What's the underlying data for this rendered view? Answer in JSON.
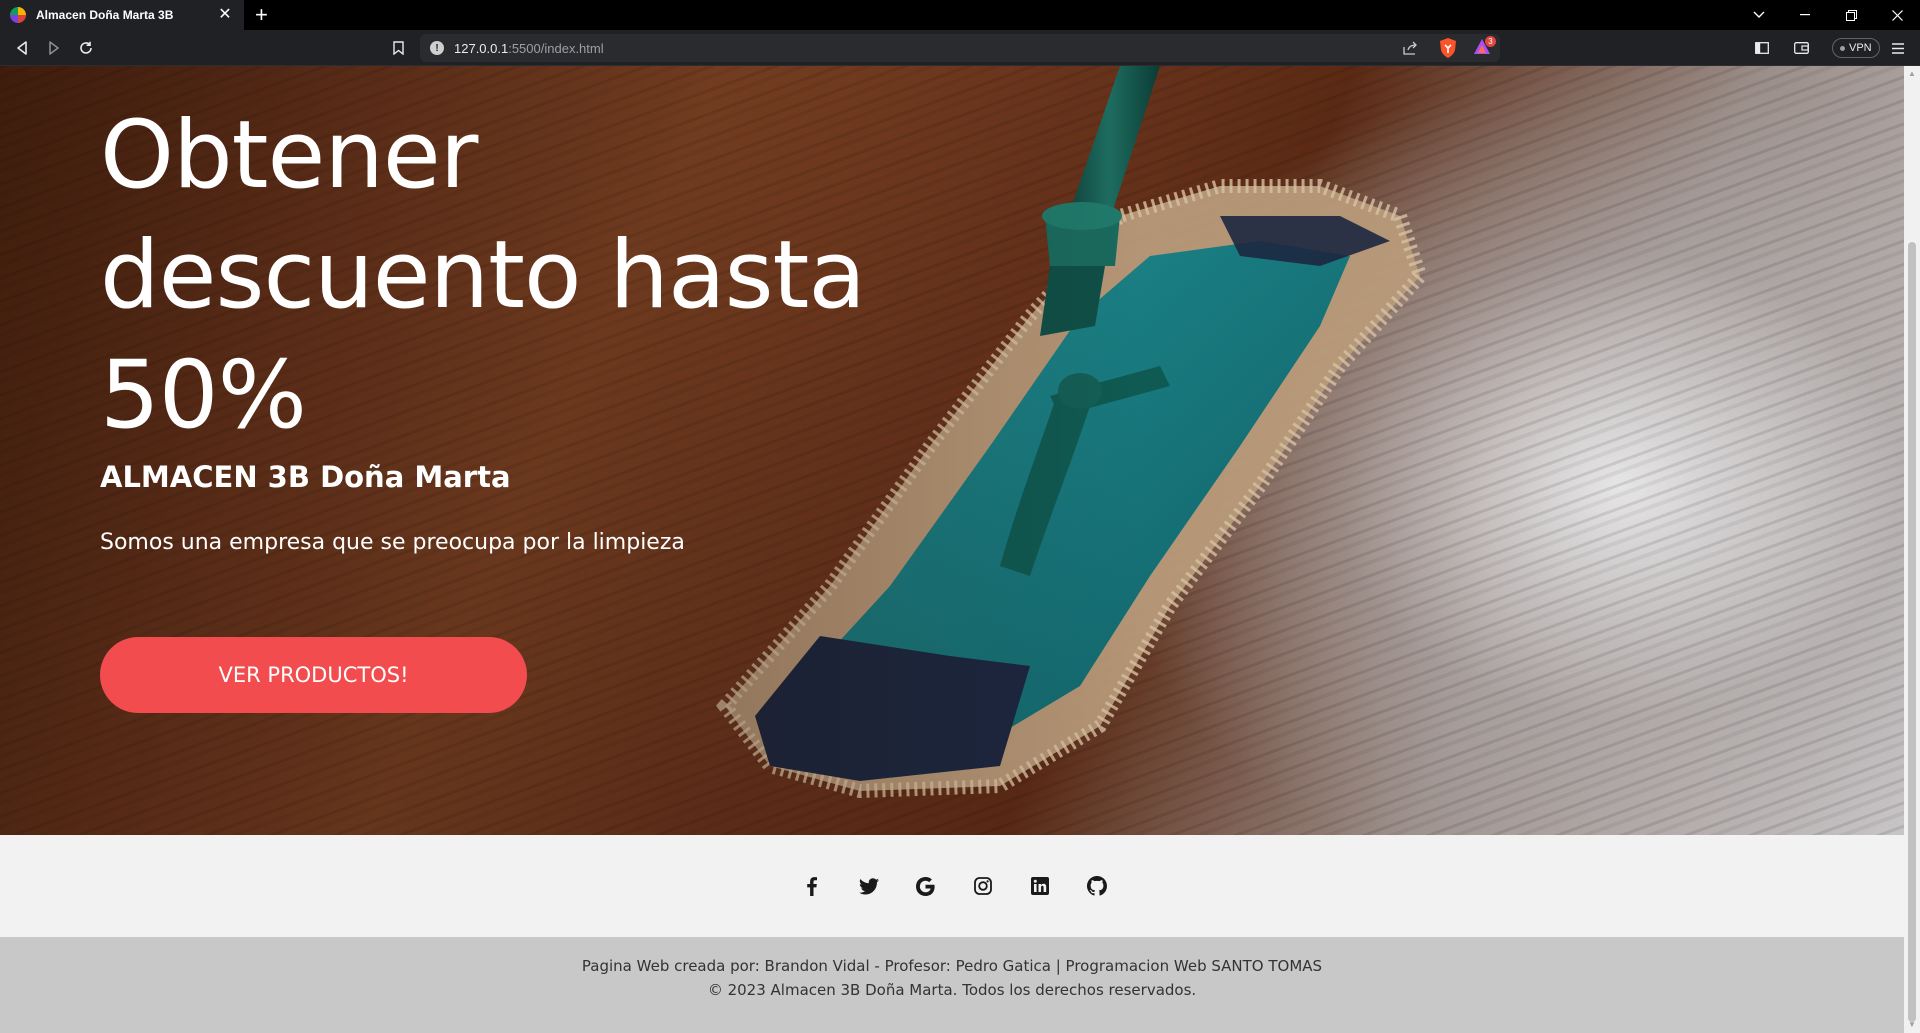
{
  "browser": {
    "tab_title": "Almacen Doña Marta 3B",
    "tab_close": "✕",
    "new_tab": "+",
    "url_host": "127.0.0.1",
    "url_rest": ":5500/index.html",
    "vpn_label": "VPN",
    "rewards_count": "3"
  },
  "hero": {
    "title_line1": "Obtener",
    "title_line2": "descuento hasta",
    "title_line3": "50%",
    "subtitle": "ALMACEN 3B Doña Marta",
    "text": "Somos una empresa que se preocupa por la limpieza",
    "button": "VER PRODUCTOS!"
  },
  "social": {
    "icons": [
      "facebook-icon",
      "twitter-icon",
      "google-icon",
      "instagram-icon",
      "linkedin-icon",
      "github-icon"
    ]
  },
  "footer": {
    "line1": "Pagina Web creada por: Brandon Vidal - Profesor: Pedro Gatica | Programacion Web SANTO TOMAS",
    "line2": "© 2023 Almacen 3B Doña Marta. Todos los derechos reservados."
  },
  "colors": {
    "accent": "#f24c4f",
    "footer_bg": "#c8c8c8",
    "social_bg": "#f2f2f2"
  }
}
